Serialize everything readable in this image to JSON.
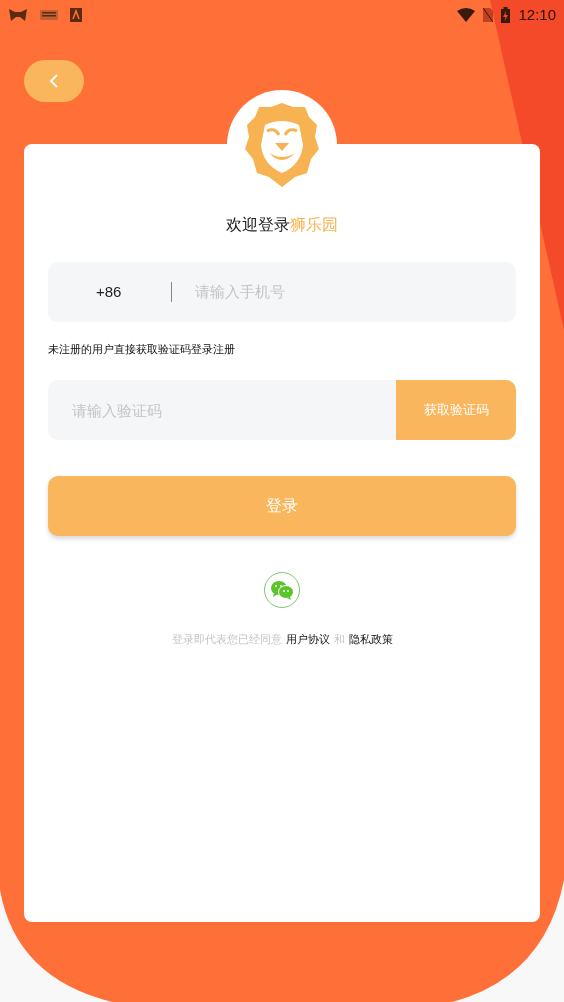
{
  "status_bar": {
    "time": "12:10"
  },
  "title": {
    "text": "欢迎登录",
    "highlight": "狮乐园"
  },
  "phone_field": {
    "country_code": "+86",
    "placeholder": "请输入手机号"
  },
  "hint": "未注册的用户直接获取验证码登录注册",
  "code_field": {
    "placeholder": "请输入验证码",
    "button": "获取验证码"
  },
  "login_button": "登录",
  "agreement": {
    "text": "登录即代表您已经同意",
    "links": [
      {
        "label": "用户协议"
      },
      {
        "label": "隐私政策"
      }
    ],
    "conjunction": "和"
  }
}
